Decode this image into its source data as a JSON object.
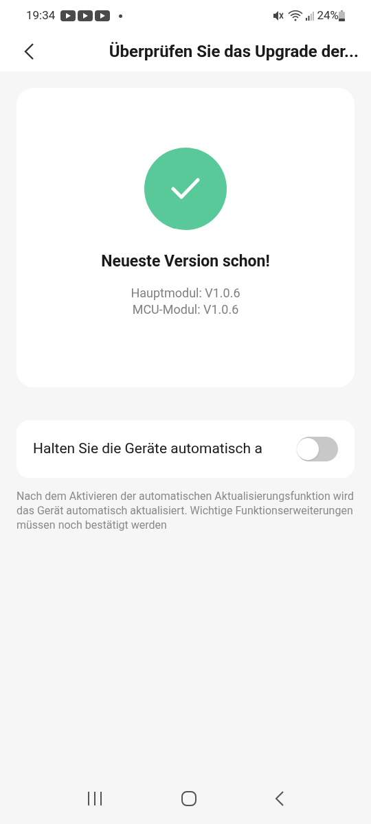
{
  "status_bar": {
    "time": "19:34",
    "battery": "24%"
  },
  "header": {
    "title": "Überprüfen Sie das Upgrade der..."
  },
  "status_card": {
    "title": "Neueste Version schon!",
    "versions": [
      "Hauptmodul: V1.0.6",
      "MCU-Modul: V1.0.6"
    ]
  },
  "auto_update": {
    "label": "Halten Sie die Geräte automatisch a",
    "on": false
  },
  "note": "Nach dem Aktivieren der automatischen Aktualisierungsfunktion wird das Gerät automatisch aktualisiert. Wichtige Funktionserweiterungen müssen noch bestätigt werden"
}
